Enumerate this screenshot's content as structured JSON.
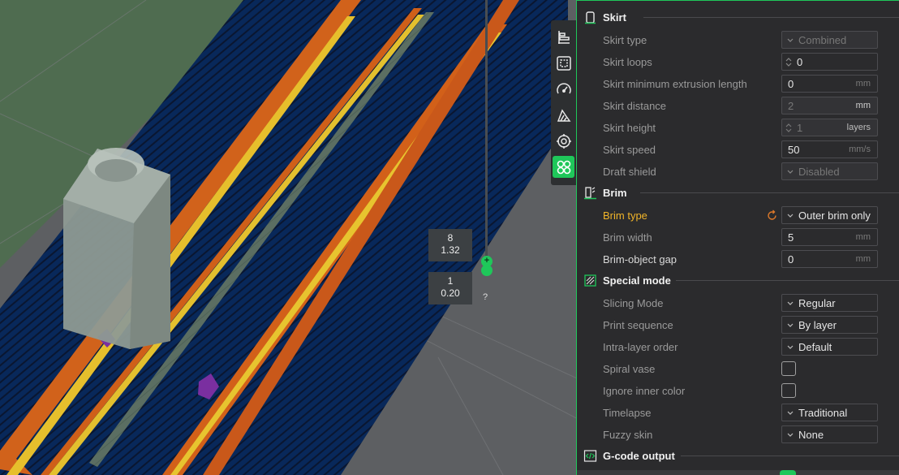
{
  "viewport": {
    "layer_top": {
      "layer": "8",
      "height": "1.32"
    },
    "layer_bottom": {
      "layer": "1",
      "height": "0.20"
    },
    "slider_plus": "+",
    "help_mark": "?",
    "toolbar": [
      {
        "icon": "layer-arrange-icon",
        "active": false
      },
      {
        "icon": "select-region-icon",
        "active": false
      },
      {
        "icon": "speedometer-icon",
        "active": false
      },
      {
        "icon": "support-paint-icon",
        "active": false
      },
      {
        "icon": "seam-target-icon",
        "active": false
      },
      {
        "icon": "multi-part-icon",
        "active": true
      }
    ]
  },
  "panel": {
    "sections": {
      "skirt": "Skirt",
      "brim": "Brim",
      "special": "Special mode",
      "gcode": "G-code output"
    },
    "rows": {
      "skirt_type": {
        "label": "Skirt type",
        "value": "Combined"
      },
      "skirt_loops": {
        "label": "Skirt loops",
        "value": "0"
      },
      "skirt_min": {
        "label": "Skirt minimum extrusion length",
        "value": "0",
        "unit": "mm"
      },
      "skirt_dist": {
        "label": "Skirt distance",
        "value": "2",
        "unit": "mm"
      },
      "skirt_height": {
        "label": "Skirt height",
        "value": "1",
        "unit": "layers"
      },
      "skirt_speed": {
        "label": "Skirt speed",
        "value": "50",
        "unit": "mm/s"
      },
      "draft_shield": {
        "label": "Draft shield",
        "value": "Disabled"
      },
      "brim_type": {
        "label": "Brim type",
        "value": "Outer brim only"
      },
      "brim_width": {
        "label": "Brim width",
        "value": "5",
        "unit": "mm"
      },
      "brim_gap": {
        "label": "Brim-object gap",
        "value": "0",
        "unit": "mm"
      },
      "slicing_mode": {
        "label": "Slicing Mode",
        "value": "Regular"
      },
      "print_seq": {
        "label": "Print sequence",
        "value": "By layer"
      },
      "intra_layer": {
        "label": "Intra-layer order",
        "value": "Default"
      },
      "spiral_vase": {
        "label": "Spiral vase",
        "checked": false
      },
      "ignore_color": {
        "label": "Ignore inner color",
        "checked": false
      },
      "timelapse": {
        "label": "Timelapse",
        "value": "Traditional"
      },
      "fuzzy_skin": {
        "label": "Fuzzy skin",
        "value": "None"
      }
    }
  },
  "colors": {
    "accent": "#1fc75a",
    "modified": "#f0b429",
    "panel_bg": "#2b2b2d",
    "infill_blue": "#0a2a5e",
    "perimeter_orange": "#d2691e",
    "perimeter_yellow": "#e0c030"
  }
}
